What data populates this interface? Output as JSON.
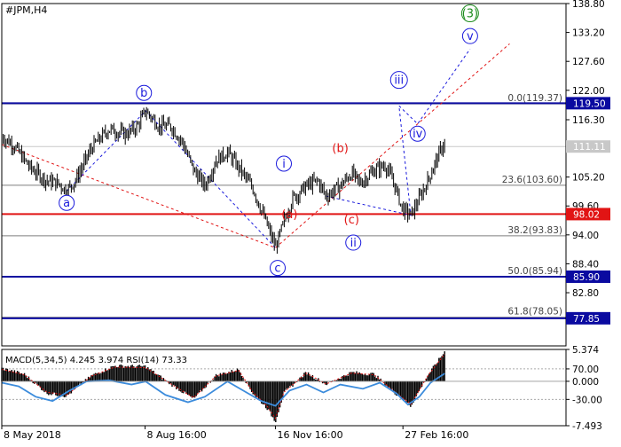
{
  "chart_data": {
    "type": "candlestick",
    "symbol_label": "#JPM,H4",
    "x_ticks": [
      {
        "label": "8 May 2018",
        "t": 0.0
      },
      {
        "label": "8 Aug 16:00",
        "t": 0.254
      },
      {
        "label": "16 Nov 16:00",
        "t": 0.485
      },
      {
        "label": "27 Feb 16:00",
        "t": 0.711
      }
    ],
    "main": {
      "ylim": [
        72.5,
        138.8
      ],
      "y_ticks": [
        "138.80",
        "133.20",
        "127.60",
        "122.00",
        "116.30",
        "111.11",
        "105.20",
        "99.60",
        "94.00",
        "88.40",
        "82.80"
      ],
      "y_tick_values": [
        138.8,
        133.2,
        127.6,
        122.0,
        116.3,
        111.11,
        105.2,
        99.6,
        94.0,
        88.4,
        82.8
      ],
      "price_path": [
        [
          0.0,
          113.0
        ],
        [
          0.02,
          111.5
        ],
        [
          0.05,
          107.0
        ],
        [
          0.08,
          104.5
        ],
        [
          0.1,
          104.0
        ],
        [
          0.115,
          102.5
        ],
        [
          0.13,
          104.5
        ],
        [
          0.16,
          111.0
        ],
        [
          0.19,
          114.5
        ],
        [
          0.22,
          113.5
        ],
        [
          0.24,
          115.0
        ],
        [
          0.255,
          118.0
        ],
        [
          0.28,
          115.0
        ],
        [
          0.3,
          115.0
        ],
        [
          0.32,
          112.0
        ],
        [
          0.34,
          106.5
        ],
        [
          0.36,
          103.5
        ],
        [
          0.38,
          108.5
        ],
        [
          0.4,
          110.0
        ],
        [
          0.42,
          107.0
        ],
        [
          0.445,
          103.0
        ],
        [
          0.47,
          96.0
        ],
        [
          0.485,
          91.5
        ],
        [
          0.5,
          96.5
        ],
        [
          0.515,
          101.0
        ],
        [
          0.54,
          103.5
        ],
        [
          0.56,
          104.5
        ],
        [
          0.575,
          101.5
        ],
        [
          0.6,
          103.5
        ],
        [
          0.62,
          106.0
        ],
        [
          0.635,
          104.0
        ],
        [
          0.66,
          106.5
        ],
        [
          0.68,
          107.5
        ],
        [
          0.695,
          104.0
        ],
        [
          0.71,
          99.0
        ],
        [
          0.725,
          97.8
        ],
        [
          0.74,
          101.0
        ],
        [
          0.755,
          104.5
        ],
        [
          0.77,
          108.5
        ],
        [
          0.785,
          112.0
        ]
      ],
      "horizontal_lines": [
        {
          "value": 119.5,
          "color": "#0a0aa0",
          "label": "119.50",
          "type": "resistance"
        },
        {
          "value": 98.02,
          "color": "#e11414",
          "label": "98.02",
          "type": "pivot"
        },
        {
          "value": 85.9,
          "color": "#0a0aa0",
          "label": "85.90",
          "type": "support"
        },
        {
          "value": 77.85,
          "color": "#0a0aa0",
          "label": "77.85",
          "type": "support"
        }
      ],
      "fib_levels": [
        {
          "label": "0.0(119.37)",
          "value": 119.37
        },
        {
          "label": "23.6(103.60)",
          "value": 103.6
        },
        {
          "label": "38.2(93.83)",
          "value": 93.83
        },
        {
          "label": "50.0(85.94)",
          "value": 85.94
        },
        {
          "label": "61.8(78.05)",
          "value": 78.05
        }
      ],
      "current_price": {
        "label": "111.11",
        "value": 111.11
      },
      "wave_labels": [
        {
          "text": "a",
          "t": 0.115,
          "value": 100.2,
          "color": "#1a1adc",
          "circle": true
        },
        {
          "text": "b",
          "t": 0.252,
          "value": 121.5,
          "color": "#1a1adc",
          "circle": true
        },
        {
          "text": "c",
          "t": 0.489,
          "value": 87.6,
          "color": "#1a1adc",
          "circle": true
        },
        {
          "text": "i",
          "t": 0.5,
          "value": 107.8,
          "color": "#1a1adc",
          "circle": true
        },
        {
          "text": "(a)",
          "t": 0.51,
          "value": 98.0,
          "color": "#e11414",
          "circle": false
        },
        {
          "text": "(b)",
          "t": 0.6,
          "value": 110.8,
          "color": "#e11414",
          "circle": false
        },
        {
          "text": "(c)",
          "t": 0.62,
          "value": 97.0,
          "color": "#e11414",
          "circle": false
        },
        {
          "text": "ii",
          "t": 0.623,
          "value": 92.5,
          "color": "#1a1adc",
          "circle": true
        },
        {
          "text": "iii",
          "t": 0.704,
          "value": 124.0,
          "color": "#1a1adc",
          "circle": true
        },
        {
          "text": "iv",
          "t": 0.737,
          "value": 113.6,
          "color": "#1a1adc",
          "circle": true
        },
        {
          "text": "v",
          "t": 0.83,
          "value": 132.5,
          "color": "#1a1adc",
          "circle": true
        },
        {
          "text": "(3)",
          "t": 0.83,
          "value": 136.9,
          "color": "#1e8c1e",
          "circle": true
        }
      ],
      "wave_paths": [
        {
          "color": "#e11414",
          "dashed": true,
          "points": [
            [
              0.0,
              111.5
            ],
            [
              0.485,
              91.5
            ],
            [
              0.9,
              131.0
            ]
          ]
        },
        {
          "color": "#1a1adc",
          "dashed": true,
          "points": [
            [
              0.115,
              102.5
            ],
            [
              0.255,
              118.0
            ],
            [
              0.485,
              91.5
            ]
          ]
        },
        {
          "color": "#1a1adc",
          "dashed": true,
          "points": [
            [
              0.575,
              101.5
            ],
            [
              0.725,
              97.8
            ],
            [
              0.704,
              119.0
            ],
            [
              0.737,
              115.5
            ],
            [
              0.83,
              130.0
            ]
          ]
        }
      ]
    },
    "macd_panel": {
      "label": "MACD(5,34,5) 4.245 3.974 RSI(14) 73.33",
      "macd_name": "MACD(5,34,5)",
      "macd_value": 4.245,
      "signal_value": 3.974,
      "rsi_name": "RSI(14)",
      "rsi_value": 73.33,
      "y_ticks": [
        "5.374",
        "70.00",
        "0.000",
        "-30.00",
        "-7.493"
      ],
      "macd_range": [
        -7.493,
        5.374
      ],
      "macd_hist": [
        [
          0.0,
          2.2
        ],
        [
          0.04,
          1.2
        ],
        [
          0.08,
          -2.0
        ],
        [
          0.115,
          -2.5
        ],
        [
          0.16,
          1.0
        ],
        [
          0.2,
          2.6
        ],
        [
          0.255,
          2.5
        ],
        [
          0.3,
          -0.5
        ],
        [
          0.34,
          -3.0
        ],
        [
          0.38,
          1.0
        ],
        [
          0.42,
          2.0
        ],
        [
          0.445,
          -2.0
        ],
        [
          0.47,
          -4.5
        ],
        [
          0.485,
          -6.8
        ],
        [
          0.5,
          -2.0
        ],
        [
          0.54,
          1.5
        ],
        [
          0.575,
          -0.5
        ],
        [
          0.62,
          1.5
        ],
        [
          0.66,
          1.2
        ],
        [
          0.695,
          -1.8
        ],
        [
          0.725,
          -4.2
        ],
        [
          0.755,
          1.0
        ],
        [
          0.785,
          5.0
        ]
      ],
      "rsi_path": [
        [
          0.0,
          58
        ],
        [
          0.03,
          52
        ],
        [
          0.06,
          35
        ],
        [
          0.09,
          28
        ],
        [
          0.12,
          45
        ],
        [
          0.15,
          60
        ],
        [
          0.19,
          62
        ],
        [
          0.23,
          55
        ],
        [
          0.255,
          60
        ],
        [
          0.29,
          38
        ],
        [
          0.33,
          26
        ],
        [
          0.36,
          35
        ],
        [
          0.4,
          60
        ],
        [
          0.43,
          44
        ],
        [
          0.46,
          28
        ],
        [
          0.485,
          20
        ],
        [
          0.51,
          45
        ],
        [
          0.54,
          55
        ],
        [
          0.57,
          42
        ],
        [
          0.6,
          55
        ],
        [
          0.64,
          48
        ],
        [
          0.67,
          58
        ],
        [
          0.7,
          40
        ],
        [
          0.72,
          22
        ],
        [
          0.74,
          35
        ],
        [
          0.76,
          58
        ],
        [
          0.785,
          73
        ]
      ]
    }
  }
}
